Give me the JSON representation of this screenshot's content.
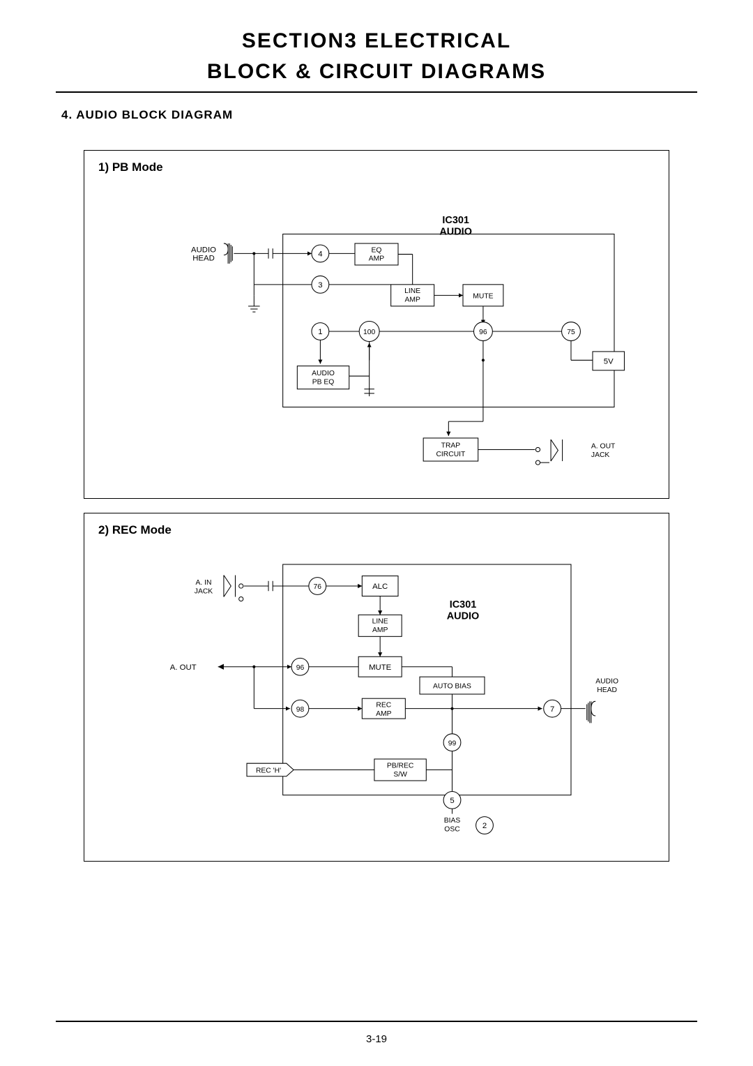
{
  "header": {
    "line1": "SECTION3   ELECTRICAL",
    "line2": "BLOCK & CIRCUIT DIAGRAMS"
  },
  "subsection_title": "4. AUDIO BLOCK DIAGRAM",
  "diagram1": {
    "title": "1) PB Mode",
    "ic_label": [
      "IC301",
      "AUDIO"
    ],
    "audio_head": [
      "AUDIO",
      "HEAD"
    ],
    "eq_amp": [
      "EQ",
      "AMP"
    ],
    "line_amp": [
      "LINE",
      "AMP"
    ],
    "mute": "MUTE",
    "audio_pb_eq": [
      "AUDIO",
      "PB EQ"
    ],
    "trap_circuit": [
      "TRAP",
      "CIRCUIT"
    ],
    "a_out_jack": [
      "A. OUT",
      "JACK"
    ],
    "v5": "5V",
    "pins": {
      "p1": "1",
      "p3": "3",
      "p4": "4",
      "p75": "75",
      "p96": "96",
      "p100": "100"
    }
  },
  "diagram2": {
    "title": "2) REC Mode",
    "ic_label": [
      "IC301",
      "AUDIO"
    ],
    "a_in_jack": [
      "A. IN",
      "JACK"
    ],
    "alc": "ALC",
    "line_amp": [
      "LINE",
      "AMP"
    ],
    "mute": "MUTE",
    "a_out": "A. OUT",
    "rec_amp": [
      "REC",
      "AMP"
    ],
    "auto_bias": "AUTO BIAS",
    "audio_head": [
      "AUDIO",
      "HEAD"
    ],
    "rec_h": "REC 'H'",
    "pb_rec_sw": [
      "PB/REC",
      "S/W"
    ],
    "bias_osc": [
      "BIAS",
      "OSC"
    ],
    "pins": {
      "p2": "2",
      "p5": "5",
      "p7": "7",
      "p76": "76",
      "p96": "96",
      "p98": "98",
      "p99": "99"
    }
  },
  "page_number": "3-19"
}
